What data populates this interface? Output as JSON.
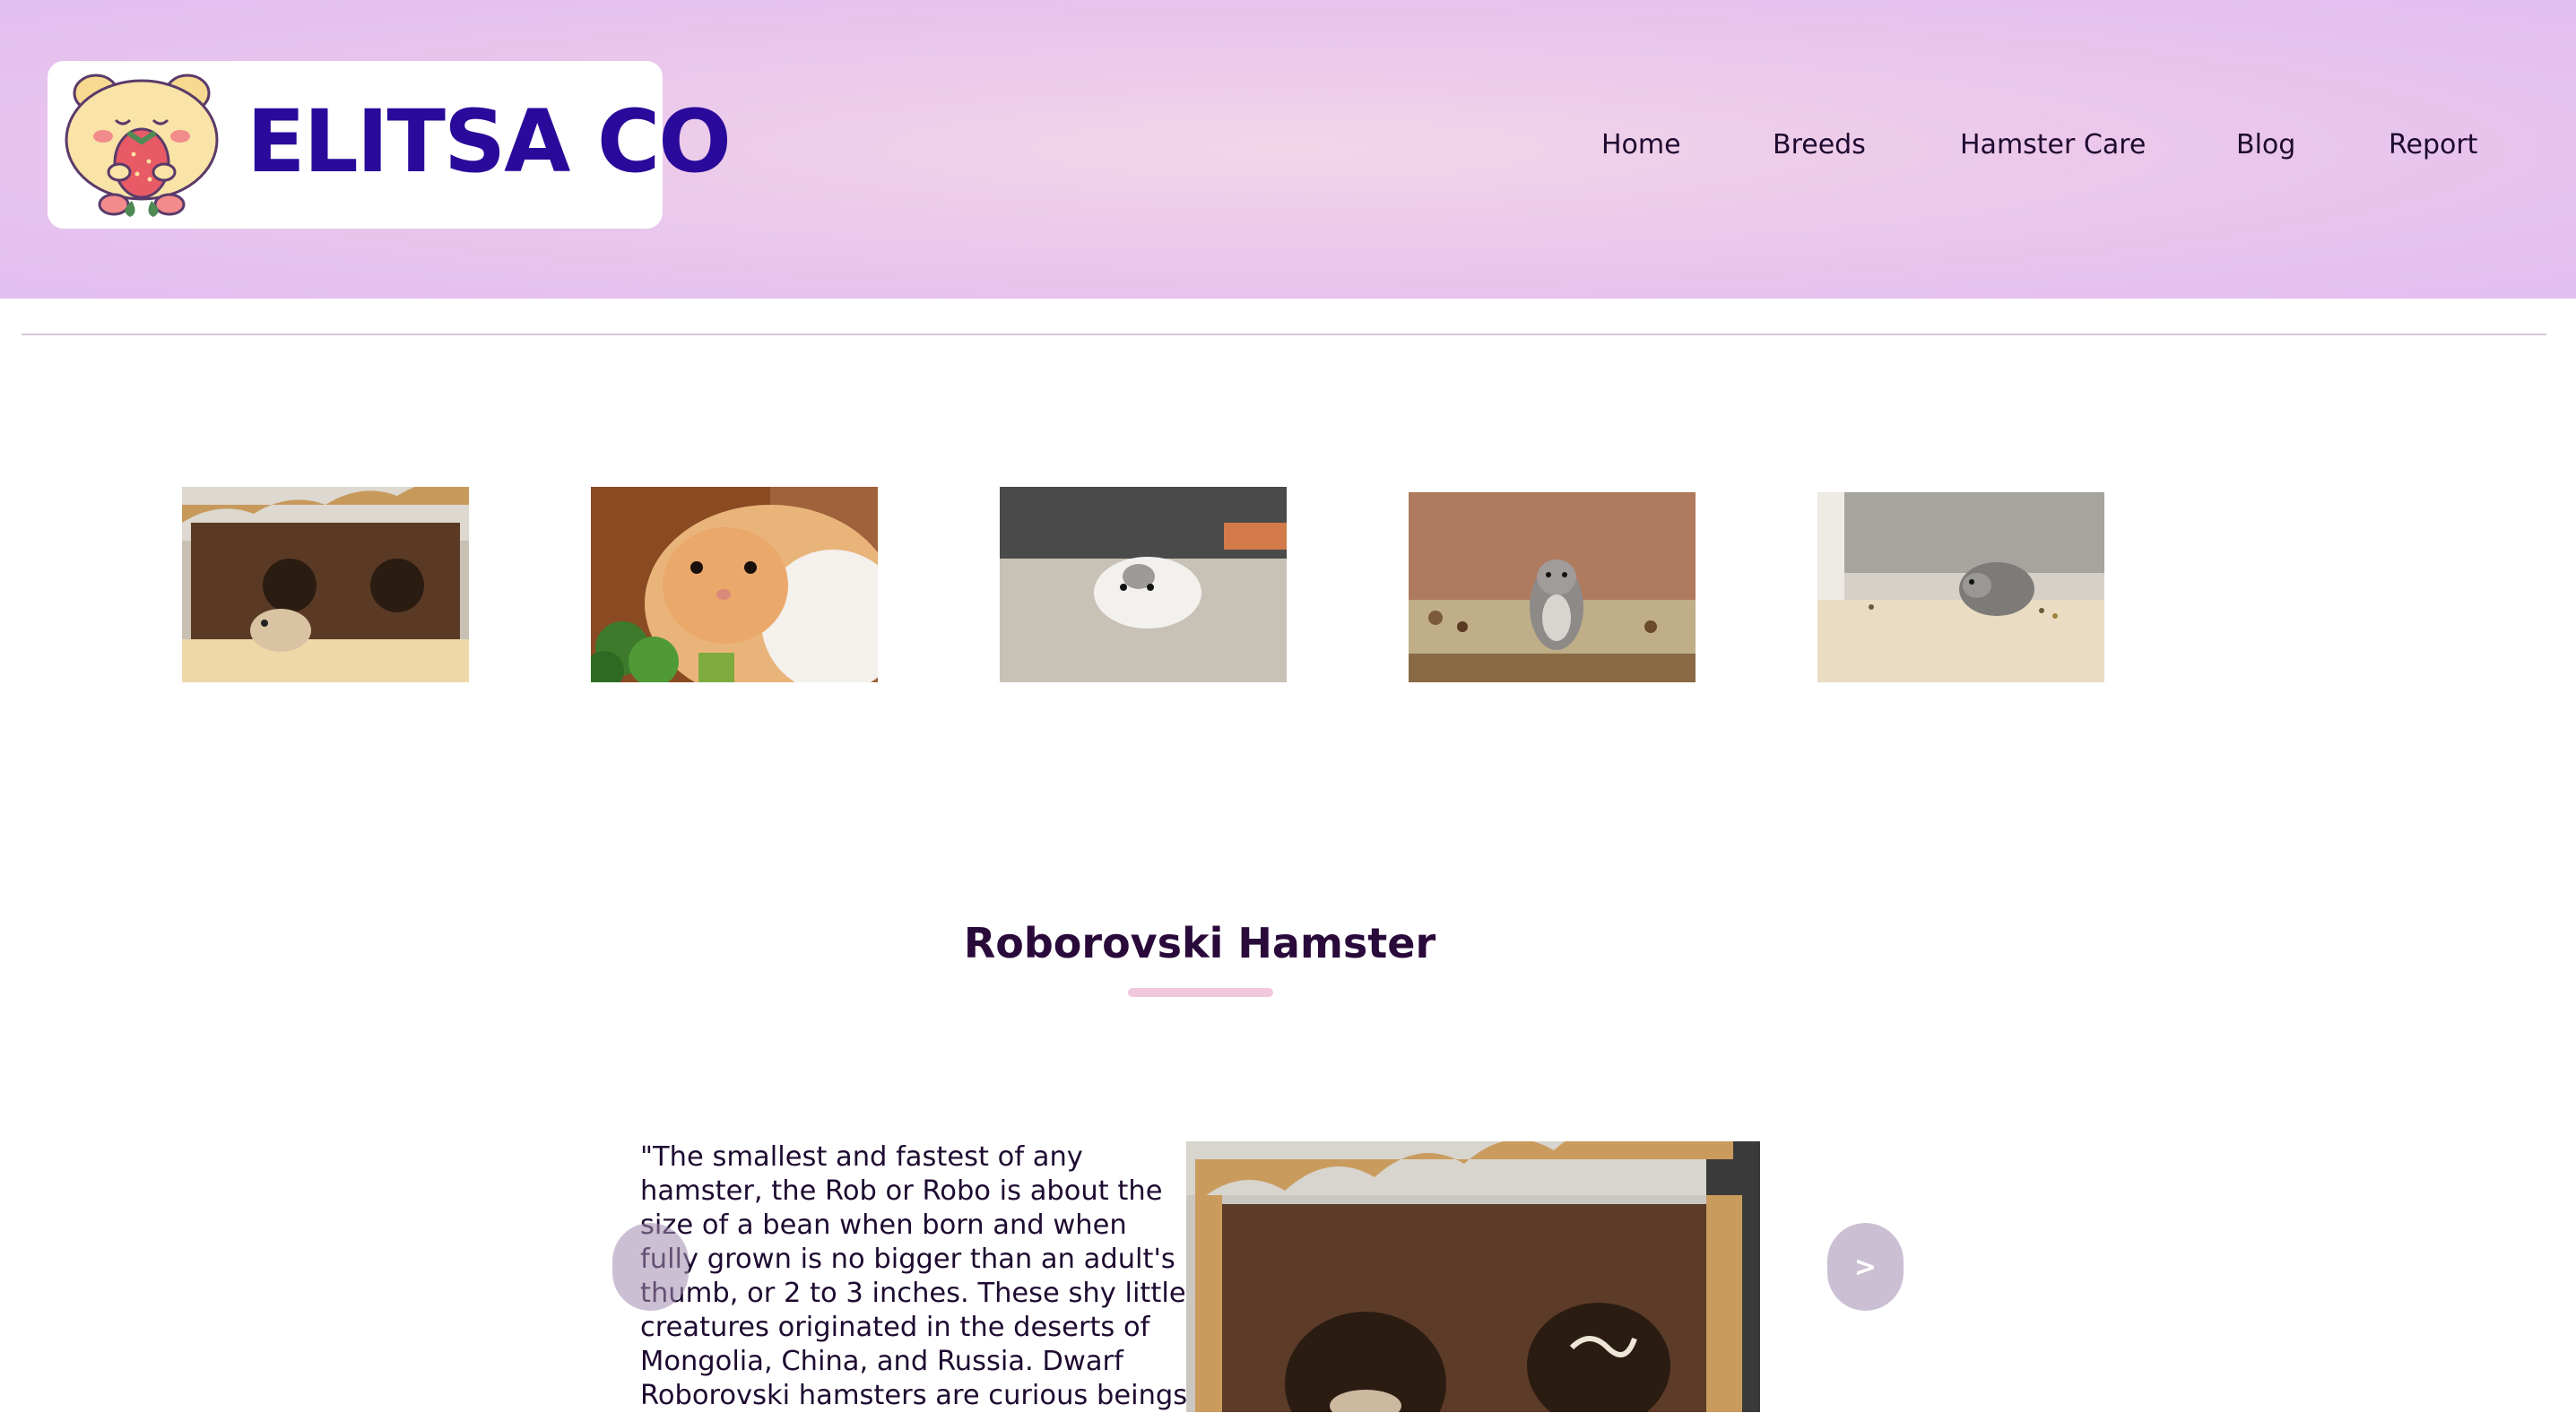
{
  "brand": {
    "name": "ELITSA CO",
    "mascot_icon": "hamster-strawberry-icon",
    "color": "#2a0a9a"
  },
  "nav": {
    "items": [
      {
        "label": "Home"
      },
      {
        "label": "Breeds"
      },
      {
        "label": "Hamster Care"
      },
      {
        "label": "Blog"
      },
      {
        "label": "Report"
      }
    ]
  },
  "gallery": {
    "thumbnails": [
      {
        "alt": "hamster in wooden house icon"
      },
      {
        "alt": "orange white hamster with broccoli icon"
      },
      {
        "alt": "white hamster on carpet icon"
      },
      {
        "alt": "grey hamster standing in seeds icon"
      },
      {
        "alt": "grey hamster on floor icon"
      }
    ]
  },
  "breed": {
    "title": "Roborovski Hamster",
    "description": "\"The smallest and fastest of any hamster, the Rob or Robo is about the size of a bean when born and when fully grown is no bigger than an adult's thumb, or 2 to 3 inches. These shy little creatures originated in the deserts of Mongolia, China, and Russia. Dwarf Roborovski hamsters are curious beings",
    "prev_label": "",
    "next_label": ">"
  },
  "colors": {
    "header_gradient_center": "#f2d6e8",
    "header_gradient_edge": "#e2bdf0",
    "title_underline": "#f0c7dc",
    "divider": "#dcc2de"
  }
}
